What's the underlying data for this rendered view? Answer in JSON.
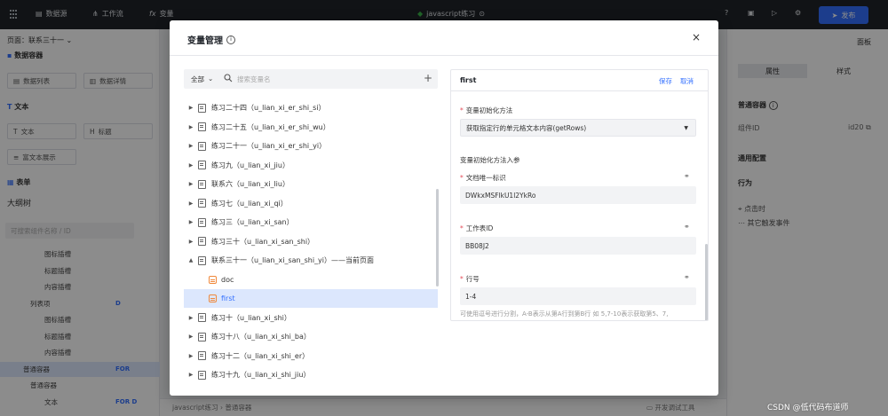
{
  "topbar": {
    "data_source": "数据源",
    "workflow": "工作流",
    "variables": "变量",
    "doc_title": "javascript练习",
    "publish": "发布"
  },
  "left_panel": {
    "page_label": "页面：联系三十一",
    "data_container": "数据容器",
    "data_list": "数据列表",
    "data_detail": "数据详情",
    "text_section": "文本",
    "text": "文本",
    "title": "标题",
    "rich_text": "富文本展示",
    "table_section": "表单",
    "outline_tree": "大纲树",
    "outline_search_placeholder": "可搜索组件名称 / ID",
    "tree": [
      {
        "label": "图标插槽",
        "badge": ""
      },
      {
        "label": "标题插槽",
        "badge": ""
      },
      {
        "label": "内容插槽",
        "badge": ""
      },
      {
        "label": "列表项",
        "badge": "D"
      },
      {
        "label": "图标插槽",
        "badge": ""
      },
      {
        "label": "标题插槽",
        "badge": ""
      },
      {
        "label": "内容插槽",
        "badge": ""
      },
      {
        "label": "普通容器",
        "badge": "FOR"
      },
      {
        "label": "普通容器",
        "badge": ""
      },
      {
        "label": "文本",
        "badge": "FOR D"
      }
    ]
  },
  "right_panel": {
    "panel_label": "面板",
    "tab_props": "属性",
    "tab_style": "样式",
    "section": "普通容器",
    "component_id_label": "组件ID",
    "component_id_value": "id20",
    "common_config": "通用配置",
    "behavior": "行为",
    "on_click": "点击时",
    "other_events": "其它触发事件"
  },
  "bottom": {
    "breadcrumb": "javascript练习 › 普通容器",
    "dev_tools": "开发调试工具"
  },
  "modal": {
    "title": "变量管理",
    "close": "×",
    "filter": "全部",
    "search_placeholder": "搜索变量名",
    "add": "+",
    "items": [
      {
        "label": "练习二十四（u_lian_xi_er_shi_si）",
        "kind": "page",
        "expand": "▶"
      },
      {
        "label": "练习二十五（u_lian_xi_er_shi_wu）",
        "kind": "page",
        "expand": "▶"
      },
      {
        "label": "练习二十一（u_lian_xi_er_shi_yi）",
        "kind": "page",
        "expand": "▶"
      },
      {
        "label": "练习九（u_lian_xi_jiu）",
        "kind": "page",
        "expand": "▶"
      },
      {
        "label": "联系六（u_lian_xi_liu）",
        "kind": "page",
        "expand": "▶"
      },
      {
        "label": "练习七（u_lian_xi_qi）",
        "kind": "page",
        "expand": "▶"
      },
      {
        "label": "练习三（u_lian_xi_san）",
        "kind": "page",
        "expand": "▶"
      },
      {
        "label": "练习三十（u_lian_xi_san_shi）",
        "kind": "page",
        "expand": "▶"
      },
      {
        "label": "联系三十一（u_lian_xi_san_shi_yi）——当前页面",
        "kind": "page",
        "expand": "▲"
      },
      {
        "label": "doc",
        "kind": "var",
        "expand": ""
      },
      {
        "label": "first",
        "kind": "var",
        "expand": "",
        "selected": true
      },
      {
        "label": "练习十（u_lian_xi_shi）",
        "kind": "page",
        "expand": "▶"
      },
      {
        "label": "练习十八（u_lian_xi_shi_ba）",
        "kind": "page",
        "expand": "▶"
      },
      {
        "label": "练习十二（u_lian_xi_shi_er）",
        "kind": "page",
        "expand": "▶"
      },
      {
        "label": "练习十九（u_lian_xi_shi_jiu）",
        "kind": "page",
        "expand": "▶"
      }
    ],
    "detail": {
      "name": "first",
      "save": "保存",
      "cancel": "取消",
      "init_method_label": "变量初始化方法",
      "init_method_value": "获取指定行的单元格文本内容(getRows)",
      "params_header": "变量初始化方法入参",
      "doc_id_label": "文档唯一标识",
      "doc_id_value": "DWkxMSFlkU1l2YkRo",
      "sheet_id_label": "工作表ID",
      "sheet_id_value": "BB08J2",
      "row_label": "行号",
      "row_value": "1-4",
      "hint": "可使用逗号进行分割，A-B表示从第A行到第B行 如 5,7-10表示获取第5、7,"
    }
  },
  "watermark": "CSDN @低代码布道师",
  "colors": {
    "accent": "#3370ff",
    "topbar": "#1f2329",
    "selected_row": "#dce7fd",
    "required": "#e34d59",
    "var_icon": "#f0883a"
  }
}
